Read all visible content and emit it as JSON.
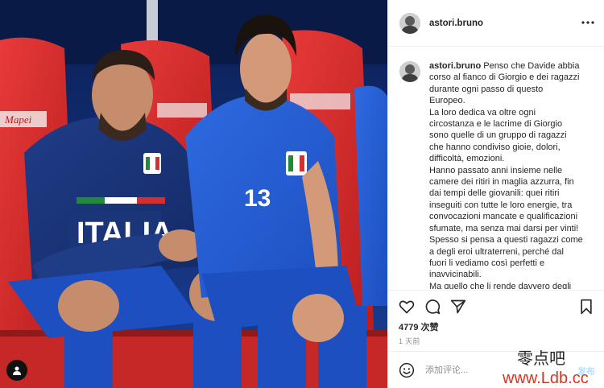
{
  "post": {
    "username": "astori.bruno",
    "caption_lines": [
      "Penso che Davide abbia",
      "corso al fianco di Giorgio e dei ragazzi",
      "durante ogni passo di questo",
      "Europeo.",
      "La loro dedica va oltre ogni",
      "circostanza e le lacrime di Giorgio",
      "sono quelle di un gruppo di ragazzi",
      "che hanno condiviso gioie, dolori,",
      "difficoltà, emozioni.",
      "Hanno passato anni insieme nelle",
      "camere dei ritiri in maglia azzurra, fin",
      "dai tempi delle giovanili: quei ritiri",
      "inseguiti con tutte le loro energie, tra",
      "convocazioni mancate e qualificazioni",
      "sfumate, ma senza mai darsi per vinti!",
      "Spesso si pensa a questi ragazzi come",
      "a degli eroi ultraterreni, perché dal",
      "fuori li vediamo così perfetti e",
      "inavvicinabili.",
      "Ma quello che li rende davvero degli"
    ],
    "likes_text": "4779 次赞",
    "time_ago": "1 天前"
  },
  "comment_box": {
    "placeholder": "添加评论...",
    "post_label": "发布"
  },
  "photo": {
    "jersey_text": "ITALIA",
    "player_number": "13",
    "seat_text": "Mapei"
  },
  "watermark": {
    "text_top": "零点吧",
    "text_bottom": "www.Ldb.cc"
  },
  "colors": {
    "accent_blue": "#0095f6",
    "post_button_disabled": "#b2dffc",
    "border": "#efefef",
    "secondary_text": "#8e8e8e"
  },
  "icons": [
    "heart-icon",
    "comment-icon",
    "share-icon",
    "bookmark-icon",
    "more-options-icon",
    "emoji-icon",
    "user-tag-icon"
  ]
}
